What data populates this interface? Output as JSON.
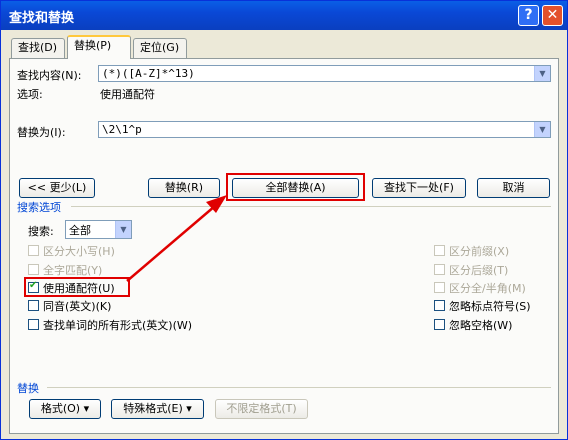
{
  "window": {
    "title": "查找和替换",
    "help_glyph": "?",
    "close_glyph": "✕"
  },
  "tabs": [
    {
      "label": "查找(D)"
    },
    {
      "label": "替换(P)",
      "active": true
    },
    {
      "label": "定位(G)"
    }
  ],
  "find": {
    "label": "查找内容(N):",
    "value": "(*)([A-Z]*^13)",
    "options_label": "选项:",
    "options_value": "使用通配符"
  },
  "replace": {
    "label": "替换为(I):",
    "value": "\\2\\1^p"
  },
  "buttons": {
    "less": "<< 更少(L)",
    "replace": "替换(R)",
    "replace_all": "全部替换(A)",
    "find_next": "查找下一处(F)",
    "cancel": "取消"
  },
  "search_options": {
    "title": "搜索选项",
    "search_label": "搜索:",
    "search_value": "全部",
    "left": [
      {
        "label": "区分大小写(H)",
        "checked": false,
        "disabled": true
      },
      {
        "label": "全字匹配(Y)",
        "checked": false,
        "disabled": true
      },
      {
        "label": "使用通配符(U)",
        "checked": true,
        "disabled": false
      },
      {
        "label": "同音(英文)(K)",
        "checked": false,
        "disabled": false
      },
      {
        "label": "查找单词的所有形式(英文)(W)",
        "checked": false,
        "disabled": false
      }
    ],
    "right": [
      {
        "label": "区分前缀(X)",
        "checked": false,
        "disabled": true
      },
      {
        "label": "区分后缀(T)",
        "checked": false,
        "disabled": true
      },
      {
        "label": "区分全/半角(M)",
        "checked": false,
        "disabled": true
      },
      {
        "label": "忽略标点符号(S)",
        "checked": false,
        "disabled": false
      },
      {
        "label": "忽略空格(W)",
        "checked": false,
        "disabled": false
      }
    ]
  },
  "replace_section": {
    "title": "替换",
    "format": "格式(O) ▾",
    "special": "特殊格式(E) ▾",
    "no_format": "不限定格式(T)"
  },
  "colors": {
    "annotation": "#e00000"
  }
}
